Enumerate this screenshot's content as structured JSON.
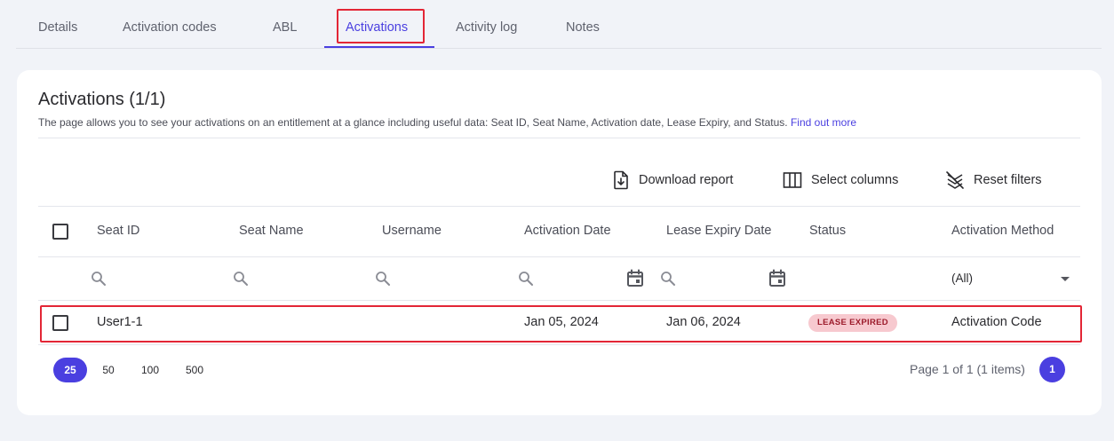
{
  "tabs": [
    {
      "label": "Details"
    },
    {
      "label": "Activation codes"
    },
    {
      "label": "ABL"
    },
    {
      "label": "Activations",
      "active": true
    },
    {
      "label": "Activity log"
    },
    {
      "label": "Notes"
    }
  ],
  "card": {
    "title": "Activations (1/1)",
    "description": "The page allows you to see your activations on an entitlement at a glance including useful data: Seat ID, Seat Name, Activation date, Lease Expiry, and Status.",
    "link_text": "Find out more"
  },
  "toolbar": {
    "download_label": "Download report",
    "download_icon": "download-report-icon",
    "columns_label": "Select columns",
    "columns_icon": "columns-icon",
    "reset_label": "Reset filters",
    "reset_icon": "filter-off-icon"
  },
  "table": {
    "columns": [
      "Seat ID",
      "Seat Name",
      "Username",
      "Activation Date",
      "Lease Expiry Date",
      "Status",
      "Activation Method"
    ],
    "method_filter": "(All)",
    "rows": [
      {
        "seat_id": "User1-1",
        "seat_name": "",
        "username": "",
        "activation_date": "Jan 05, 2024",
        "lease_expiry": "Jan 06, 2024",
        "status": "LEASE EXPIRED",
        "method": "Activation Code"
      }
    ]
  },
  "pagination": {
    "sizes": [
      "25",
      "50",
      "100",
      "500"
    ],
    "active_size": "25",
    "info": "Page 1 of 1 (1 items)",
    "current_page": "1"
  },
  "colors": {
    "accent": "#4a3fe0",
    "highlight": "#e32636",
    "badge_bg": "#f7c9cf",
    "badge_text": "#9c1b2b"
  }
}
